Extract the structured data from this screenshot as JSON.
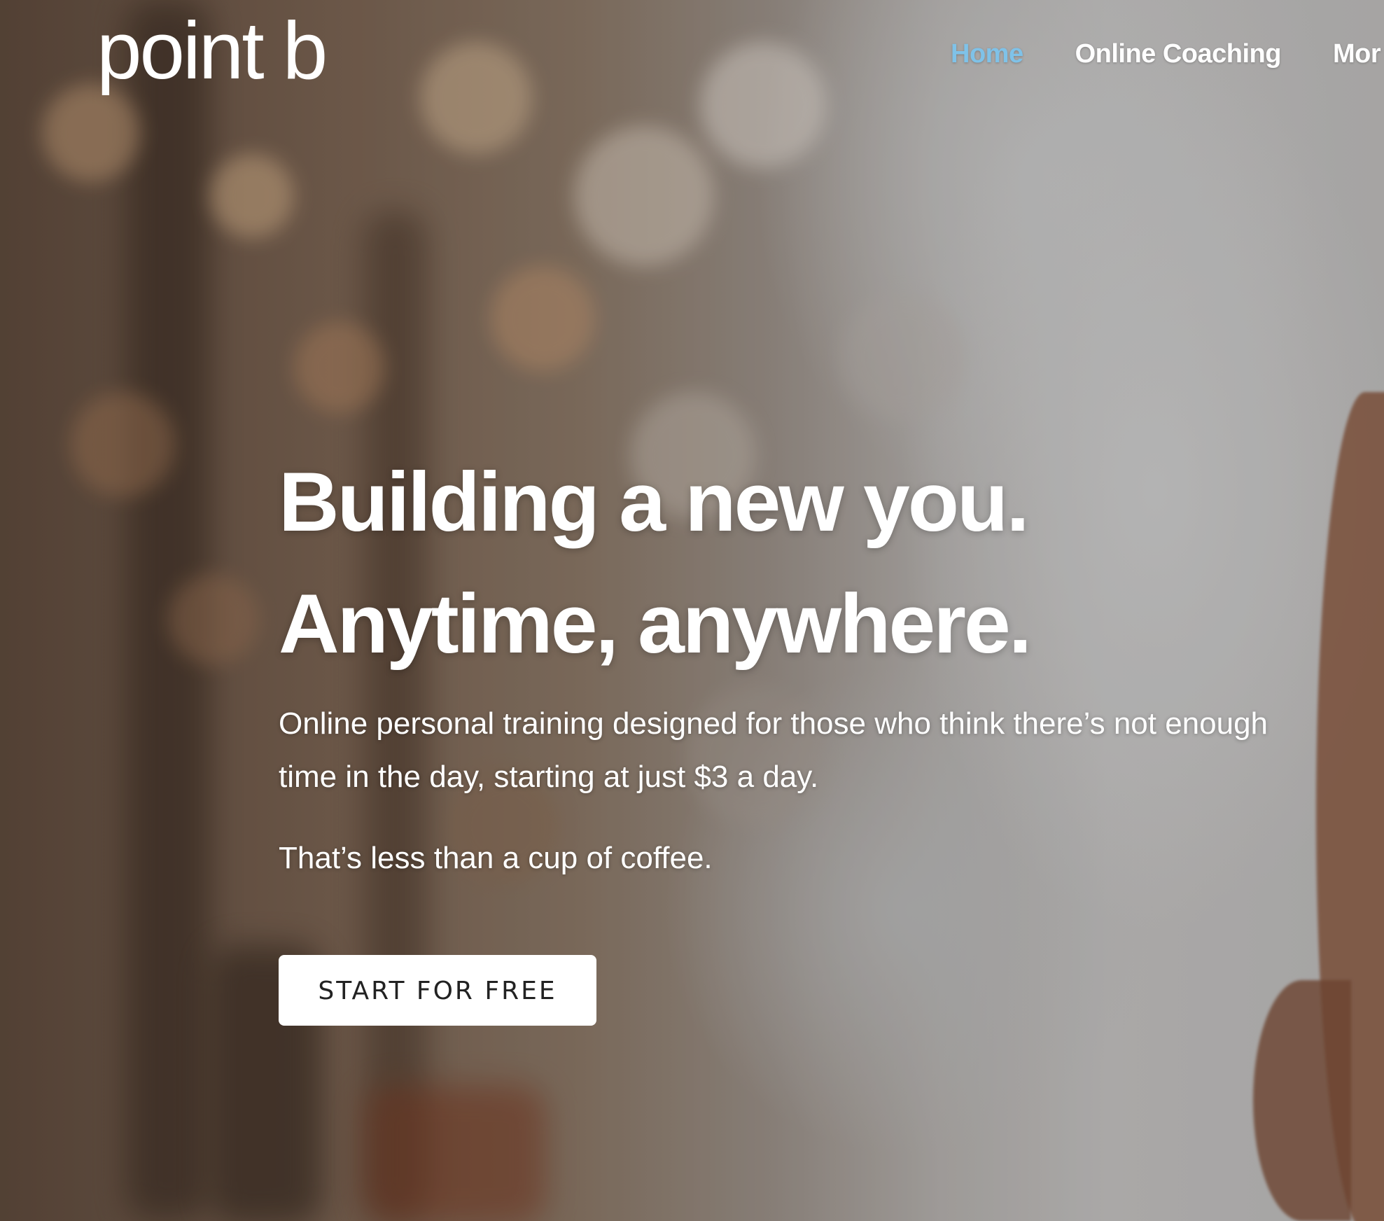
{
  "brand": {
    "logo_text": "point b"
  },
  "nav": {
    "items": [
      {
        "label": "Home",
        "active": true
      },
      {
        "label": "Online Coaching",
        "active": false
      },
      {
        "label": "Mor",
        "active": false
      }
    ],
    "active_color": "#7fc2e8"
  },
  "hero": {
    "headline_line1": "Building a new you.",
    "headline_line2": "Anytime, anywhere.",
    "description": "Online personal training designed for those who think there’s not enough time in the day, starting at just $3 a day.",
    "tagline": "That’s less than a cup of coffee.",
    "cta_label": "START FOR FREE"
  }
}
